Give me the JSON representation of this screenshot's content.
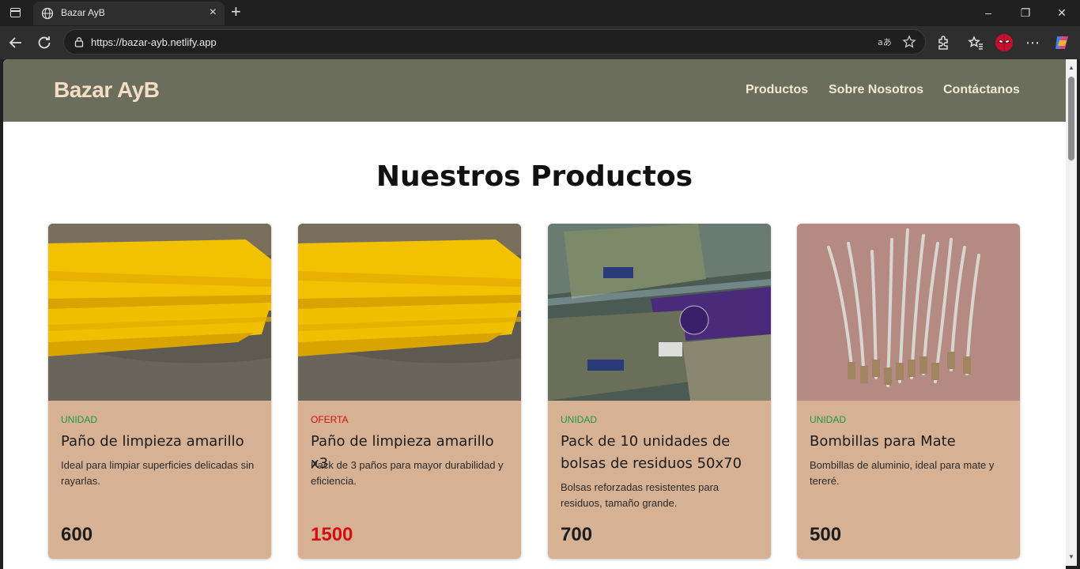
{
  "browser": {
    "tab_title": "Bazar AyB",
    "url": "https://bazar-ayb.netlify.app",
    "new_tab": "+",
    "close_tab": "×",
    "minimize": "–",
    "restore": "❐",
    "close_window": "✕"
  },
  "site": {
    "brand": "Bazar AyB",
    "nav": [
      "Productos",
      "Sobre Nosotros",
      "Contáctanos"
    ],
    "section_title": "Nuestros Productos"
  },
  "colors": {
    "header_bg": "#6b6e5c",
    "card_bg": "#d7b193",
    "tag_unidad": "#1a9c3c",
    "tag_oferta": "#d30f0f",
    "price_offer": "#d30f0f"
  },
  "products": [
    {
      "tag": "UNIDAD",
      "name": "Paño de limpieza amarillo",
      "description": "Ideal para limpiar superficies delicadas sin rayarlas.",
      "price": "600",
      "image": "yellow-cloth"
    },
    {
      "tag": "OFERTA",
      "name": "Paño de limpieza amarillo x3",
      "description": "Pack de 3 paños para mayor durabilidad y eficiencia.",
      "price": "1500",
      "image": "yellow-cloth"
    },
    {
      "tag": "UNIDAD",
      "name": "Pack de 10 unidades de bolsas de residuos 50x70",
      "description": "Bolsas reforzadas resistentes para residuos, tamaño grande.",
      "price": "700",
      "image": "trash-bags"
    },
    {
      "tag": "UNIDAD",
      "name": "Bombillas para Mate",
      "description": "Bombillas de aluminio, ideal para mate y tereré.",
      "price": "500",
      "image": "mate-straws"
    }
  ]
}
